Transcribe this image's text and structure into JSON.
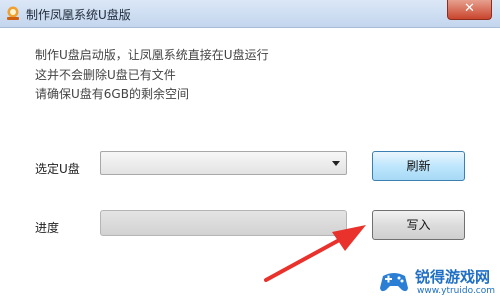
{
  "window": {
    "title": "制作凤凰系统U盘版",
    "close_glyph": "✕"
  },
  "info": {
    "line1": "制作U盘启动版，让凤凰系统直接在U盘运行",
    "line2": "这并不会删除U盘已有文件",
    "line3": "请确保U盘有6GB的剩余空间"
  },
  "drive": {
    "label": "选定U盘",
    "selected": ""
  },
  "progress": {
    "label": "进度",
    "value": 0
  },
  "buttons": {
    "refresh": "刷新",
    "write": "写入"
  },
  "watermark": {
    "name": "锐得游戏网",
    "url": "www.ytruido.com"
  },
  "colors": {
    "annotation_arrow": "#e8322b",
    "refresh_button": "#bee6fd",
    "watermark": "#1f6fc4"
  }
}
